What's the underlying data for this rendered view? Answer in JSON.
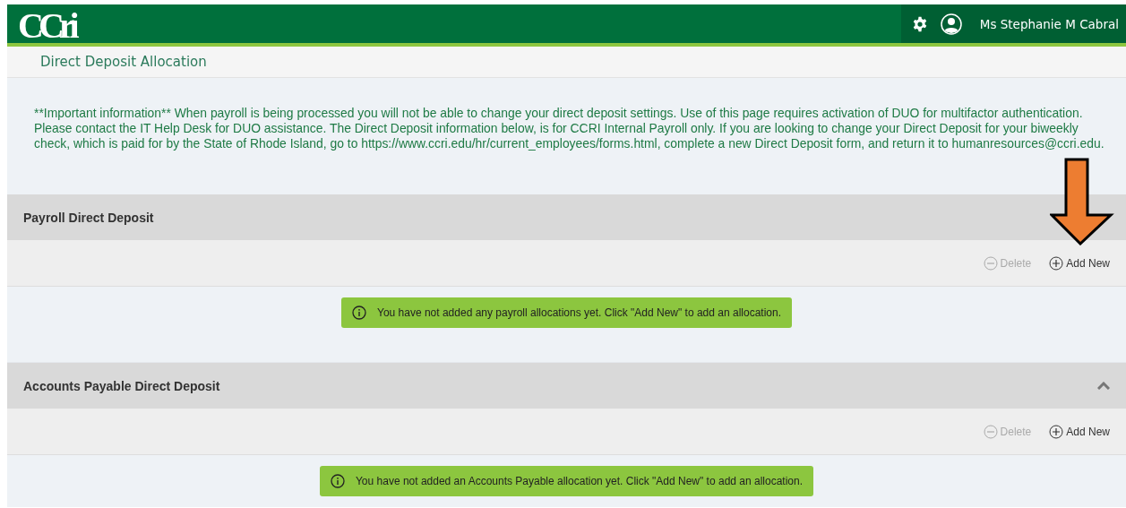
{
  "header": {
    "logo": "CCri",
    "user_name": "Ms Stephanie M Cabral"
  },
  "page_title": "Direct Deposit Allocation",
  "notice": "**Important information** When payroll is being processed you will not be able to change your direct deposit settings. Use of this page requires activation of DUO for multifactor authentication. Please contact the IT Help Desk for DUO assistance. The Direct Deposit information below, is for CCRI Internal Payroll only. If you are looking to change your Direct Deposit for your biweekly check, which is paid for by the State of Rhode Island, go to https://www.ccri.edu/hr/current_employees/forms.html, complete a new Direct Deposit form, and return it to humanresources@ccri.edu.",
  "sections": [
    {
      "title": "Payroll Direct Deposit",
      "toggle_visible": false,
      "actions": [
        {
          "label": "Delete",
          "kind": "delete",
          "disabled": true
        },
        {
          "label": "Add New",
          "kind": "add",
          "disabled": false
        }
      ],
      "message": "You have not added any payroll allocations yet. Click \"Add New\" to add an allocation."
    },
    {
      "title": "Accounts Payable Direct Deposit",
      "toggle_visible": true,
      "actions": [
        {
          "label": "Delete",
          "kind": "delete",
          "disabled": true
        },
        {
          "label": "Add New",
          "kind": "add",
          "disabled": false
        }
      ],
      "message": "You have not added an Accounts Payable allocation yet. Click \"Add New\" to add an allocation."
    }
  ],
  "annotation": {
    "kind": "arrow"
  }
}
